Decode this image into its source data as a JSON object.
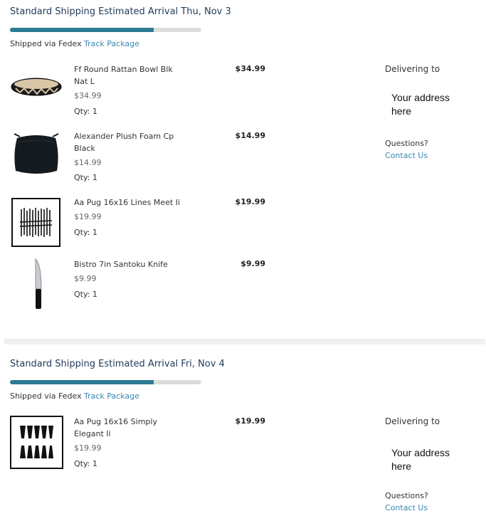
{
  "shipments": [
    {
      "title": "Standard Shipping Estimated Arrival Thu, Nov 3",
      "progress_percent": 75,
      "shipped_via": "Shipped via Fedex",
      "track_label": "Track Package",
      "delivering_to": "Delivering to",
      "address": "Your address here",
      "questions": "Questions?",
      "contact_label": "Contact Us",
      "items": [
        {
          "name": "Ff Round Rattan Bowl Blk Nat L",
          "price": "$34.99",
          "qty": "Qty: 1",
          "total": "$34.99",
          "icon": "rattan-bowl-icon"
        },
        {
          "name": "Alexander Plush Foam Cp Black",
          "price": "$14.99",
          "qty": "Qty: 1",
          "total": "$14.99",
          "icon": "chair-cushion-icon"
        },
        {
          "name": "Aa Pug 16x16 Lines Meet Ii",
          "price": "$19.99",
          "qty": "Qty: 1",
          "total": "$19.99",
          "icon": "framed-print-lines-icon"
        },
        {
          "name": "Bistro 7in Santoku Knife",
          "price": "$9.99",
          "qty": "Qty: 1",
          "total": "$9.99",
          "icon": "santoku-knife-icon"
        }
      ]
    },
    {
      "title": "Standard Shipping Estimated Arrival Fri, Nov 4",
      "progress_percent": 75,
      "shipped_via": "Shipped via Fedex",
      "track_label": "Track Package",
      "delivering_to": "Delivering to",
      "address": "Your address here",
      "questions": "Questions?",
      "contact_label": "Contact Us",
      "items": [
        {
          "name": "Aa Pug 16x16 Simply Elegant Ii",
          "price": "$19.99",
          "qty": "Qty: 1",
          "total": "$19.99",
          "icon": "framed-print-elegant-icon"
        }
      ]
    }
  ],
  "colors": {
    "progress_fill": "#2c7a93",
    "progress_track": "#dcdcdc",
    "link": "#3a86b0",
    "title": "#1f3a5a"
  }
}
